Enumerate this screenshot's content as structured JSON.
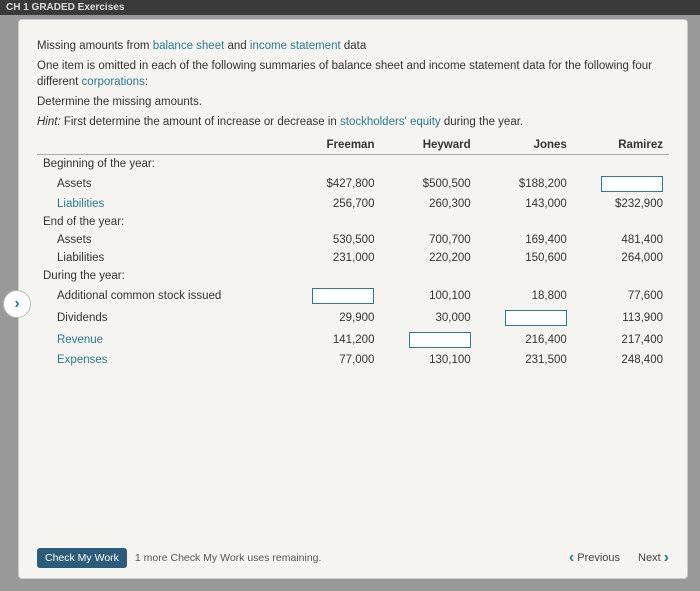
{
  "header_strip": "CH 1 GRADED Exercises",
  "problem": {
    "title": "Missing amounts from balance sheet and income statement data",
    "intro": "One item is omitted in each of the following summaries of balance sheet and income statement data for the following four different corporations:",
    "instruction": "Determine the missing amounts.",
    "hint_label": "Hint:",
    "hint_text": "First determine the amount of increase or decrease in stockholders' equity during the year.",
    "links": {
      "balance_sheet": "balance sheet",
      "income_statement": "income statement",
      "corporations": "corporations",
      "stockholders_equity": "stockholders' equity"
    }
  },
  "columns": [
    "Freeman",
    "Heyward",
    "Jones",
    "Ramirez"
  ],
  "sections": {
    "beg": "Beginning of the year:",
    "end": "End of the year:",
    "during": "During the year:"
  },
  "rows": {
    "assets": "Assets",
    "liabilities": "Liabilities",
    "addl_stock": "Additional common stock issued",
    "dividends": "Dividends",
    "revenue": "Revenue",
    "expenses": "Expenses"
  },
  "values": {
    "beg_assets": [
      "$427,800",
      "$500,500",
      "$188,200",
      "[input]"
    ],
    "beg_liabilities": [
      "256,700",
      "260,300",
      "143,000",
      "$232,900"
    ],
    "end_assets": [
      "530,500",
      "700,700",
      "169,400",
      "481,400"
    ],
    "end_liabilities": [
      "231,000",
      "220,200",
      "150,600",
      "264,000"
    ],
    "addl_stock": [
      "[input]",
      "100,100",
      "18,800",
      "77,600"
    ],
    "dividends": [
      "29,900",
      "30,000",
      "[input]",
      "113,900"
    ],
    "revenue": [
      "141,200",
      "[input]",
      "216,400",
      "217,400"
    ],
    "expenses": [
      "77,000",
      "130,100",
      "231,500",
      "248,400"
    ]
  },
  "footer": {
    "check": "Check My Work",
    "remaining": "1 more Check My Work uses remaining.",
    "prev": "Previous",
    "next": "Next"
  },
  "chart_data": {
    "type": "table",
    "title": "Missing amounts from balance sheet and income statement data",
    "columns": [
      "Freeman",
      "Heyward",
      "Jones",
      "Ramirez"
    ],
    "rows": [
      {
        "section": "Beginning of the year:",
        "item": "Assets",
        "values": [
          427800,
          500500,
          188200,
          null
        ]
      },
      {
        "section": "Beginning of the year:",
        "item": "Liabilities",
        "values": [
          256700,
          260300,
          143000,
          232900
        ]
      },
      {
        "section": "End of the year:",
        "item": "Assets",
        "values": [
          530500,
          700700,
          169400,
          481400
        ]
      },
      {
        "section": "End of the year:",
        "item": "Liabilities",
        "values": [
          231000,
          220200,
          150600,
          264000
        ]
      },
      {
        "section": "During the year:",
        "item": "Additional common stock issued",
        "values": [
          null,
          100100,
          18800,
          77600
        ]
      },
      {
        "section": "During the year:",
        "item": "Dividends",
        "values": [
          29900,
          30000,
          null,
          113900
        ]
      },
      {
        "section": "During the year:",
        "item": "Revenue",
        "values": [
          141200,
          null,
          216400,
          217400
        ]
      },
      {
        "section": "During the year:",
        "item": "Expenses",
        "values": [
          77000,
          130100,
          231500,
          248400
        ]
      }
    ]
  }
}
